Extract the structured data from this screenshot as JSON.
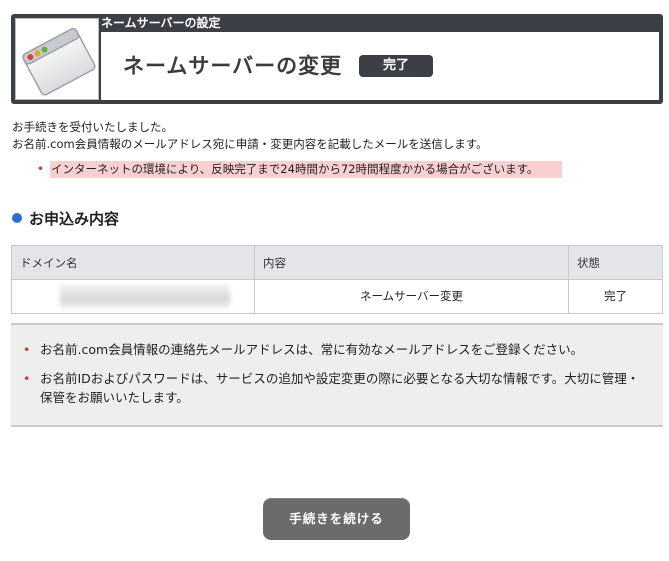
{
  "header": {
    "top_label": "ネームサーバーの設定",
    "title": "ネームサーバーの変更",
    "status_badge": "完了",
    "icon": "window-icon"
  },
  "messages": {
    "line1": "お手続きを受付いたしました。",
    "line2": "お名前.com会員情報のメールアドレス宛に申請・変更内容を記載したメールを送信します。",
    "notice": "インターネットの環境により、反映完了まで24時間から72時間程度かかる場合がございます。"
  },
  "section": {
    "heading": "お申込み内容"
  },
  "table": {
    "headers": [
      "ドメイン名",
      "内容",
      "状態"
    ],
    "rows": [
      [
        "",
        "ネームサーバー変更",
        "完了"
      ]
    ]
  },
  "info": {
    "items": [
      "お名前.com会員情報の連絡先メールアドレスは、常に有効なメールアドレスをご登録ください。",
      "お名前IDおよびパスワードは、サービスの追加や設定変更の際に必要となる大切な情報です。大切に管理・保管をお願いいたします。"
    ]
  },
  "actions": {
    "continue_label": "手続きを続ける"
  },
  "colors": {
    "header_bg": "#3c4046",
    "notice_bg": "#f9cfcf",
    "bullet_red": "#d23a3a",
    "section_dot": "#2d6fd0",
    "button_bg": "#6b6b6b"
  }
}
